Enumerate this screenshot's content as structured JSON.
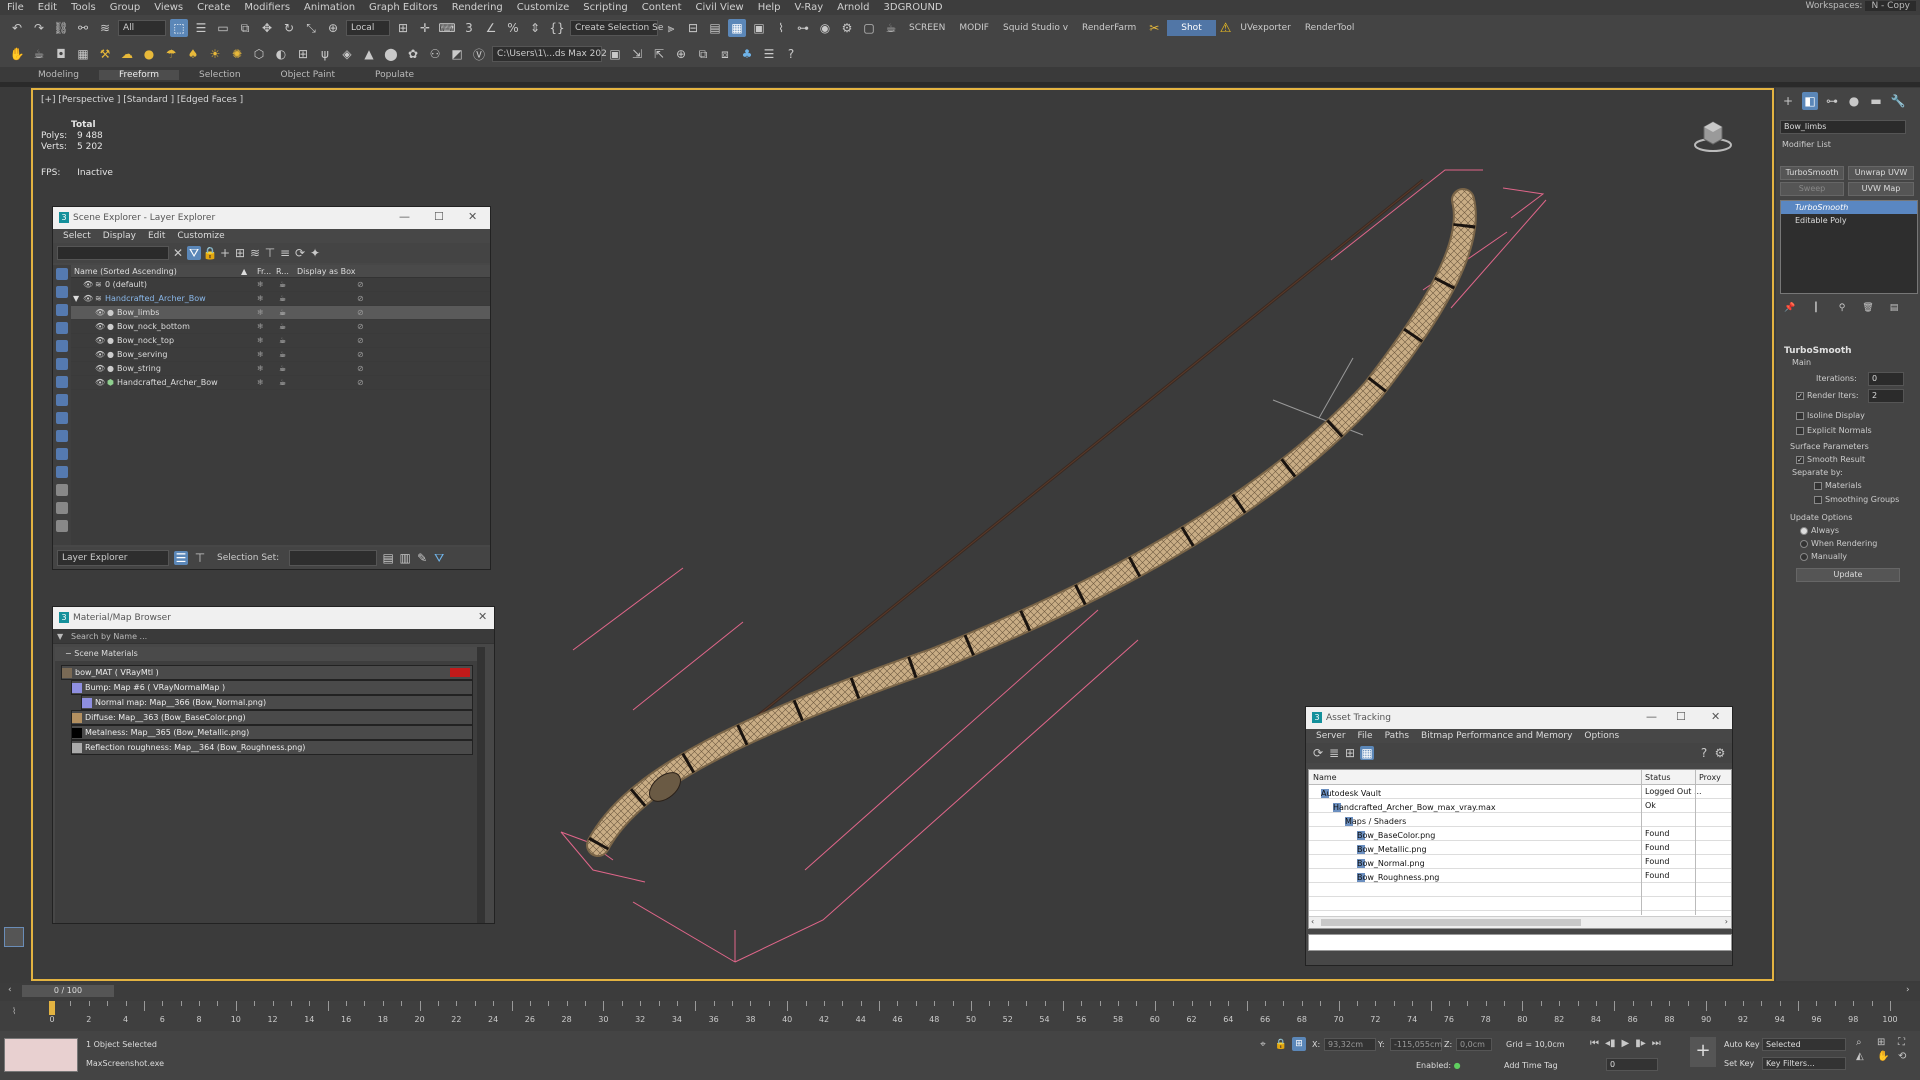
{
  "menu": [
    "File",
    "Edit",
    "Tools",
    "Group",
    "Views",
    "Create",
    "Modifiers",
    "Animation",
    "Graph Editors",
    "Rendering",
    "Customize",
    "Scripting",
    "Content",
    "Civil View",
    "Help",
    "V-Ray",
    "Arnold",
    "3DGROUND"
  ],
  "workspace": {
    "label": "Workspaces:",
    "value": "N - Copy"
  },
  "toolbar": {
    "filter_value": "All",
    "coord_value": "Local",
    "selection_set_placeholder": "Create Selection Se",
    "screen": "SCREEN",
    "modif": "MODIF",
    "squid": "Squid Studio v",
    "renderfarm": "RenderFarm",
    "shot": "Shot",
    "uvexporter": "UVexporter",
    "rendertool": "RenderTool",
    "path": "C:\\Users\\1\\...ds Max 202"
  },
  "ribbon_tabs": [
    "Modeling",
    "Freeform",
    "Selection",
    "Object Paint",
    "Populate"
  ],
  "viewport": {
    "label": "[+] [Perspective ] [Standard ] [Edged Faces ]",
    "stats_title": "Total",
    "polys_label": "Polys:",
    "polys": "9 488",
    "verts_label": "Verts:",
    "verts": "5 202",
    "fps_label": "FPS:",
    "fps": "Inactive"
  },
  "scene_explorer": {
    "title": "Scene Explorer - Layer Explorer",
    "menu": [
      "Select",
      "Display",
      "Edit",
      "Customize"
    ],
    "col_name": "Name (Sorted Ascending)",
    "col_pr": "Fr...",
    "col_r": "R...",
    "col_box": "Display as Box",
    "rows": [
      {
        "name": "0 (default)",
        "indent": 0,
        "type": "layer",
        "selected": false
      },
      {
        "name": "Handcrafted_Archer_Bow",
        "indent": 0,
        "type": "layer-open",
        "selected": false
      },
      {
        "name": "Bow_limbs",
        "indent": 1,
        "type": "object",
        "selected": true
      },
      {
        "name": "Bow_nock_bottom",
        "indent": 1,
        "type": "object",
        "selected": false
      },
      {
        "name": "Bow_nock_top",
        "indent": 1,
        "type": "object",
        "selected": false
      },
      {
        "name": "Bow_serving",
        "indent": 1,
        "type": "object",
        "selected": false
      },
      {
        "name": "Bow_string",
        "indent": 1,
        "type": "object",
        "selected": false
      },
      {
        "name": "Handcrafted_Archer_Bow",
        "indent": 1,
        "type": "group",
        "selected": false
      }
    ],
    "footer_mode": "Layer Explorer",
    "selection_set_label": "Selection Set:"
  },
  "material_browser": {
    "title": "Material/Map Browser",
    "search_placeholder": "Search by Name ...",
    "section": "Scene Materials",
    "rows": [
      {
        "text": "bow_MAT ( VRayMtl )",
        "indent": 0,
        "swatch": "#7a6a55"
      },
      {
        "text": "Bump: Map #6 ( VRayNormalMap )",
        "indent": 1,
        "swatch": "#8f8fe0"
      },
      {
        "text": "Normal map: Map__366 (Bow_Normal.png)",
        "indent": 2,
        "swatch": "#8f8fe0"
      },
      {
        "text": "Diffuse: Map__363 (Bow_BaseColor.png)",
        "indent": 1,
        "swatch": "#b39060"
      },
      {
        "text": "Metalness: Map__365 (Bow_Metallic.png)",
        "indent": 1,
        "swatch": "#000000"
      },
      {
        "text": "Reflection roughness: Map__364 (Bow_Roughness.png)",
        "indent": 1,
        "swatch": "#aaaaaa"
      }
    ]
  },
  "asset_tracking": {
    "title": "Asset Tracking",
    "menu": [
      "Server",
      "File",
      "Paths",
      "Bitmap Performance and Memory",
      "Options"
    ],
    "col_name": "Name",
    "col_status": "Status",
    "col_proxy": "Proxy",
    "rows": [
      {
        "name": "Autodesk Vault",
        "status": "Logged Out ...",
        "indent": 0
      },
      {
        "name": "Handcrafted_Archer_Bow_max_vray.max",
        "status": "Ok",
        "indent": 1
      },
      {
        "name": "Maps / Shaders",
        "status": "",
        "indent": 2
      },
      {
        "name": "Bow_BaseColor.png",
        "status": "Found",
        "indent": 3
      },
      {
        "name": "Bow_Metallic.png",
        "status": "Found",
        "indent": 3
      },
      {
        "name": "Bow_Normal.png",
        "status": "Found",
        "indent": 3
      },
      {
        "name": "Bow_Roughness.png",
        "status": "Found",
        "indent": 3
      }
    ]
  },
  "command_panel": {
    "object_name": "Bow_limbs",
    "modifier_list": "Modifier List",
    "btn_turbosmooth": "TurboSmooth",
    "btn_unwrap": "Unwrap UVW",
    "btn_sweep": "Sweep",
    "btn_uvwmap": "UVW Map",
    "stack": [
      "TurboSmooth",
      "Editable Poly"
    ],
    "section": "TurboSmooth",
    "main": "Main",
    "iterations_label": "Iterations:",
    "iterations": "0",
    "render_iters_label": "Render Iters:",
    "render_iters": "2",
    "isoline": "Isoline Display",
    "explicit_normals": "Explicit Normals",
    "surface_params": "Surface Parameters",
    "smooth_result": "Smooth Result",
    "separate_by": "Separate by:",
    "materials": "Materials",
    "smoothing_groups": "Smoothing Groups",
    "update_options": "Update Options",
    "always": "Always",
    "when_rendering": "When Rendering",
    "manually": "Manually",
    "update_btn": "Update"
  },
  "timeline": {
    "position": "0 / 100",
    "start": 0,
    "end": 100,
    "current": 0,
    "labels": [
      0,
      2,
      4,
      6,
      8,
      10,
      12,
      14,
      16,
      18,
      20,
      22,
      24,
      26,
      28,
      30,
      32,
      34,
      36,
      38,
      40,
      42,
      44,
      46,
      48,
      50,
      52,
      54,
      56,
      58,
      60,
      62,
      64,
      66,
      68,
      70,
      72,
      74,
      76,
      78,
      80,
      82,
      84,
      86,
      88,
      90,
      92,
      94,
      96,
      98,
      100
    ]
  },
  "statusbar": {
    "selected": "1 Object Selected",
    "script": "MaxScreenshot.exe",
    "x_label": "X:",
    "x": "93,32cm",
    "y_label": "Y:",
    "y": "-115,055cm",
    "z_label": "Z:",
    "z": "0,0cm",
    "grid": "Grid = 10,0cm",
    "enabled": "Enabled:",
    "add_time_tag": "Add Time Tag",
    "autokey": "Auto Key",
    "setkey": "Set Key",
    "selected_dd": "Selected",
    "key_filters": "Key Filters...",
    "frame": "0"
  }
}
